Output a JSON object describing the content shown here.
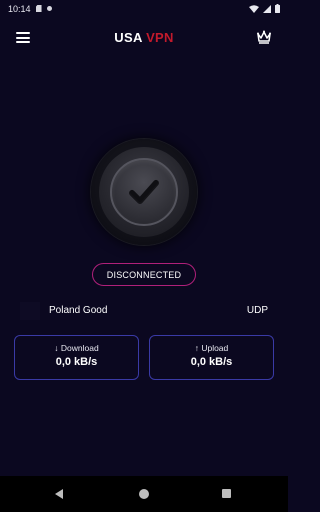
{
  "status_bar": {
    "time": "10:14",
    "icons": [
      "sd-card-icon",
      "notification-dot-icon",
      "wifi-icon",
      "signal-icon",
      "battery-icon"
    ]
  },
  "app_bar": {
    "title_part1": "USA",
    "title_part2": "VPN",
    "icons": [
      "menu-icon",
      "crown-icon"
    ]
  },
  "colors": {
    "background": "#0b0820",
    "brand_red": "#c21a2c",
    "pill_border": "#b0207a",
    "card_border": "#3a3aa6"
  },
  "connect_button": {
    "icon": "check-icon"
  },
  "connection_status": "DISCONNECTED",
  "server": {
    "name": "Poland  Good",
    "protocol": "UDP"
  },
  "stats": {
    "download_label": "↓ Download",
    "download_value": "0,0 kB/s",
    "upload_label": "↑ Upload",
    "upload_value": "0,0 kB/s"
  },
  "nav_bar": {
    "icons": [
      "back-icon",
      "home-icon",
      "recents-icon"
    ]
  }
}
